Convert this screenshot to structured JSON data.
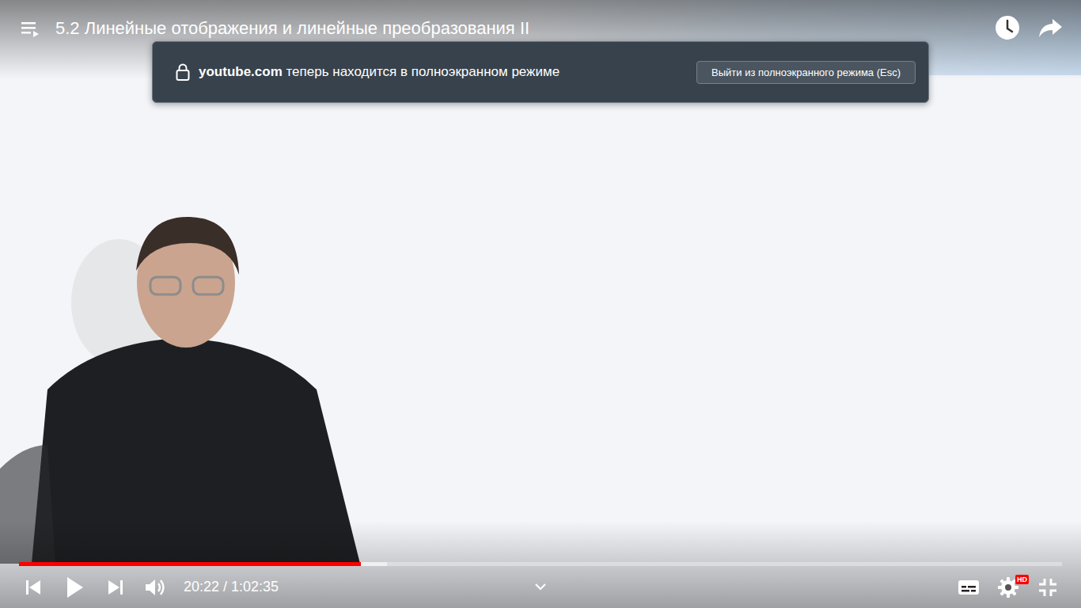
{
  "player": {
    "title": "5.2 Линейные отображения и линейные преобразования II",
    "playing": false,
    "time": "20:22 / 1:02:35",
    "progress": {
      "level": 0.328,
      "buffered": 0.353
    },
    "settings_badge": "HD"
  },
  "toast": {
    "domain": "youtube.com",
    "message": "теперь находится в полноэкранном режиме",
    "button": "Выйти из полноэкранного режима (Esc)"
  }
}
